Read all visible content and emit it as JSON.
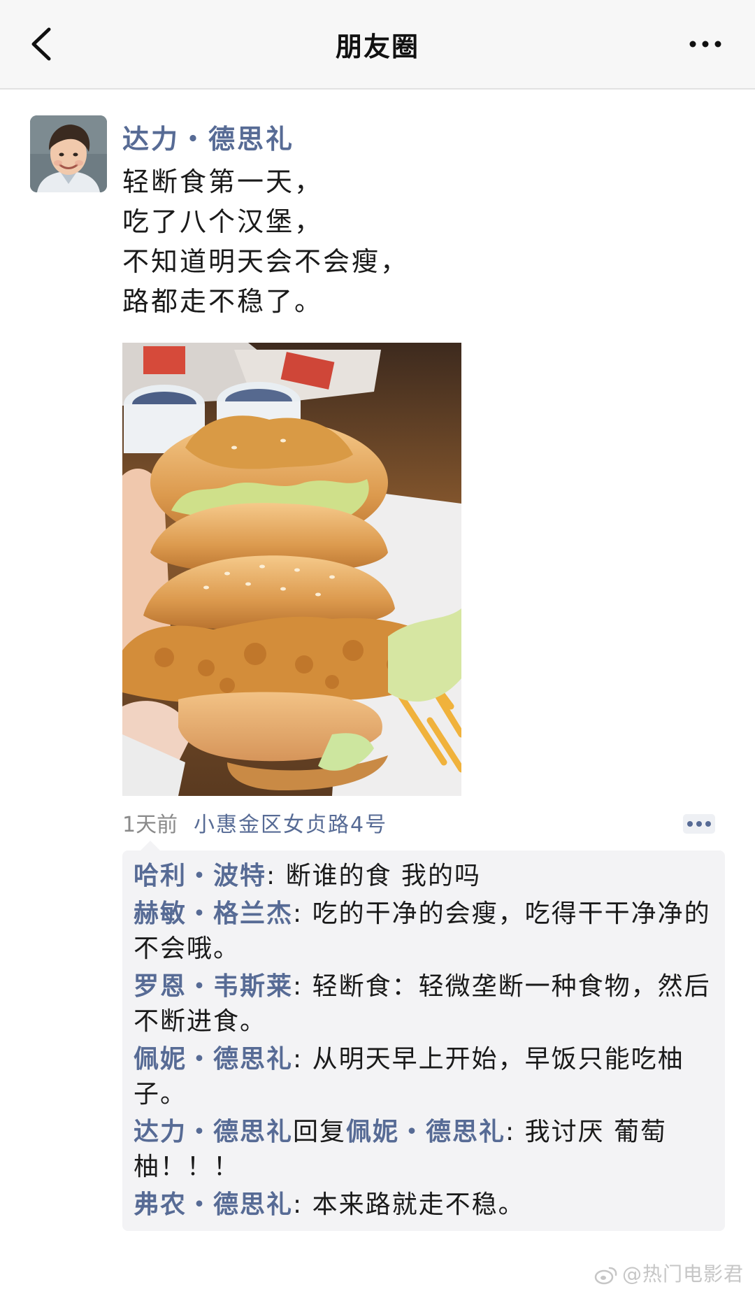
{
  "nav": {
    "back_icon": "chevron-left-icon",
    "title": "朋友圈",
    "more_icon": "ellipsis-icon"
  },
  "post": {
    "avatar_icon": "avatar",
    "author": "达力・德思礼",
    "text_lines": [
      "轻断食第一天，",
      "吃了八个汉堡，",
      "不知道明天会不会瘦，",
      "路都走不稳了。"
    ],
    "photo_icon": "burger-photo",
    "time": "1天前",
    "location": "小惠金区女贞路4号",
    "more_icon": "action-dots-icon"
  },
  "comments": [
    {
      "name": "哈利・波特",
      "sep": ": ",
      "text": "断谁的食 我的吗"
    },
    {
      "name": "赫敏・格兰杰",
      "sep": ": ",
      "text": "吃的干净的会瘦，吃得干干净净的不会哦。"
    },
    {
      "name": "罗恩・韦斯莱",
      "sep": ": ",
      "text": "轻断食：轻微垄断一种食物，然后不断进食。"
    },
    {
      "name": "佩妮・德思礼",
      "sep": ": ",
      "text": "从明天早上开始，早饭只能吃柚子。"
    },
    {
      "name": "达力・德思礼",
      "reply_word": "回复",
      "reply_to": "佩妮・德思礼",
      "sep": ": ",
      "text": "我讨厌 葡萄柚！！！"
    },
    {
      "name": "弗农・德思礼",
      "sep": ": ",
      "text": "本来路就走不稳。"
    }
  ],
  "watermark": {
    "icon": "weibo-icon",
    "text": "@热门电影君"
  },
  "colors": {
    "link": "#576b95",
    "navbar_bg": "#f7f7f7",
    "comment_bg": "#f3f3f5",
    "meta_text": "#8a8a8a"
  }
}
